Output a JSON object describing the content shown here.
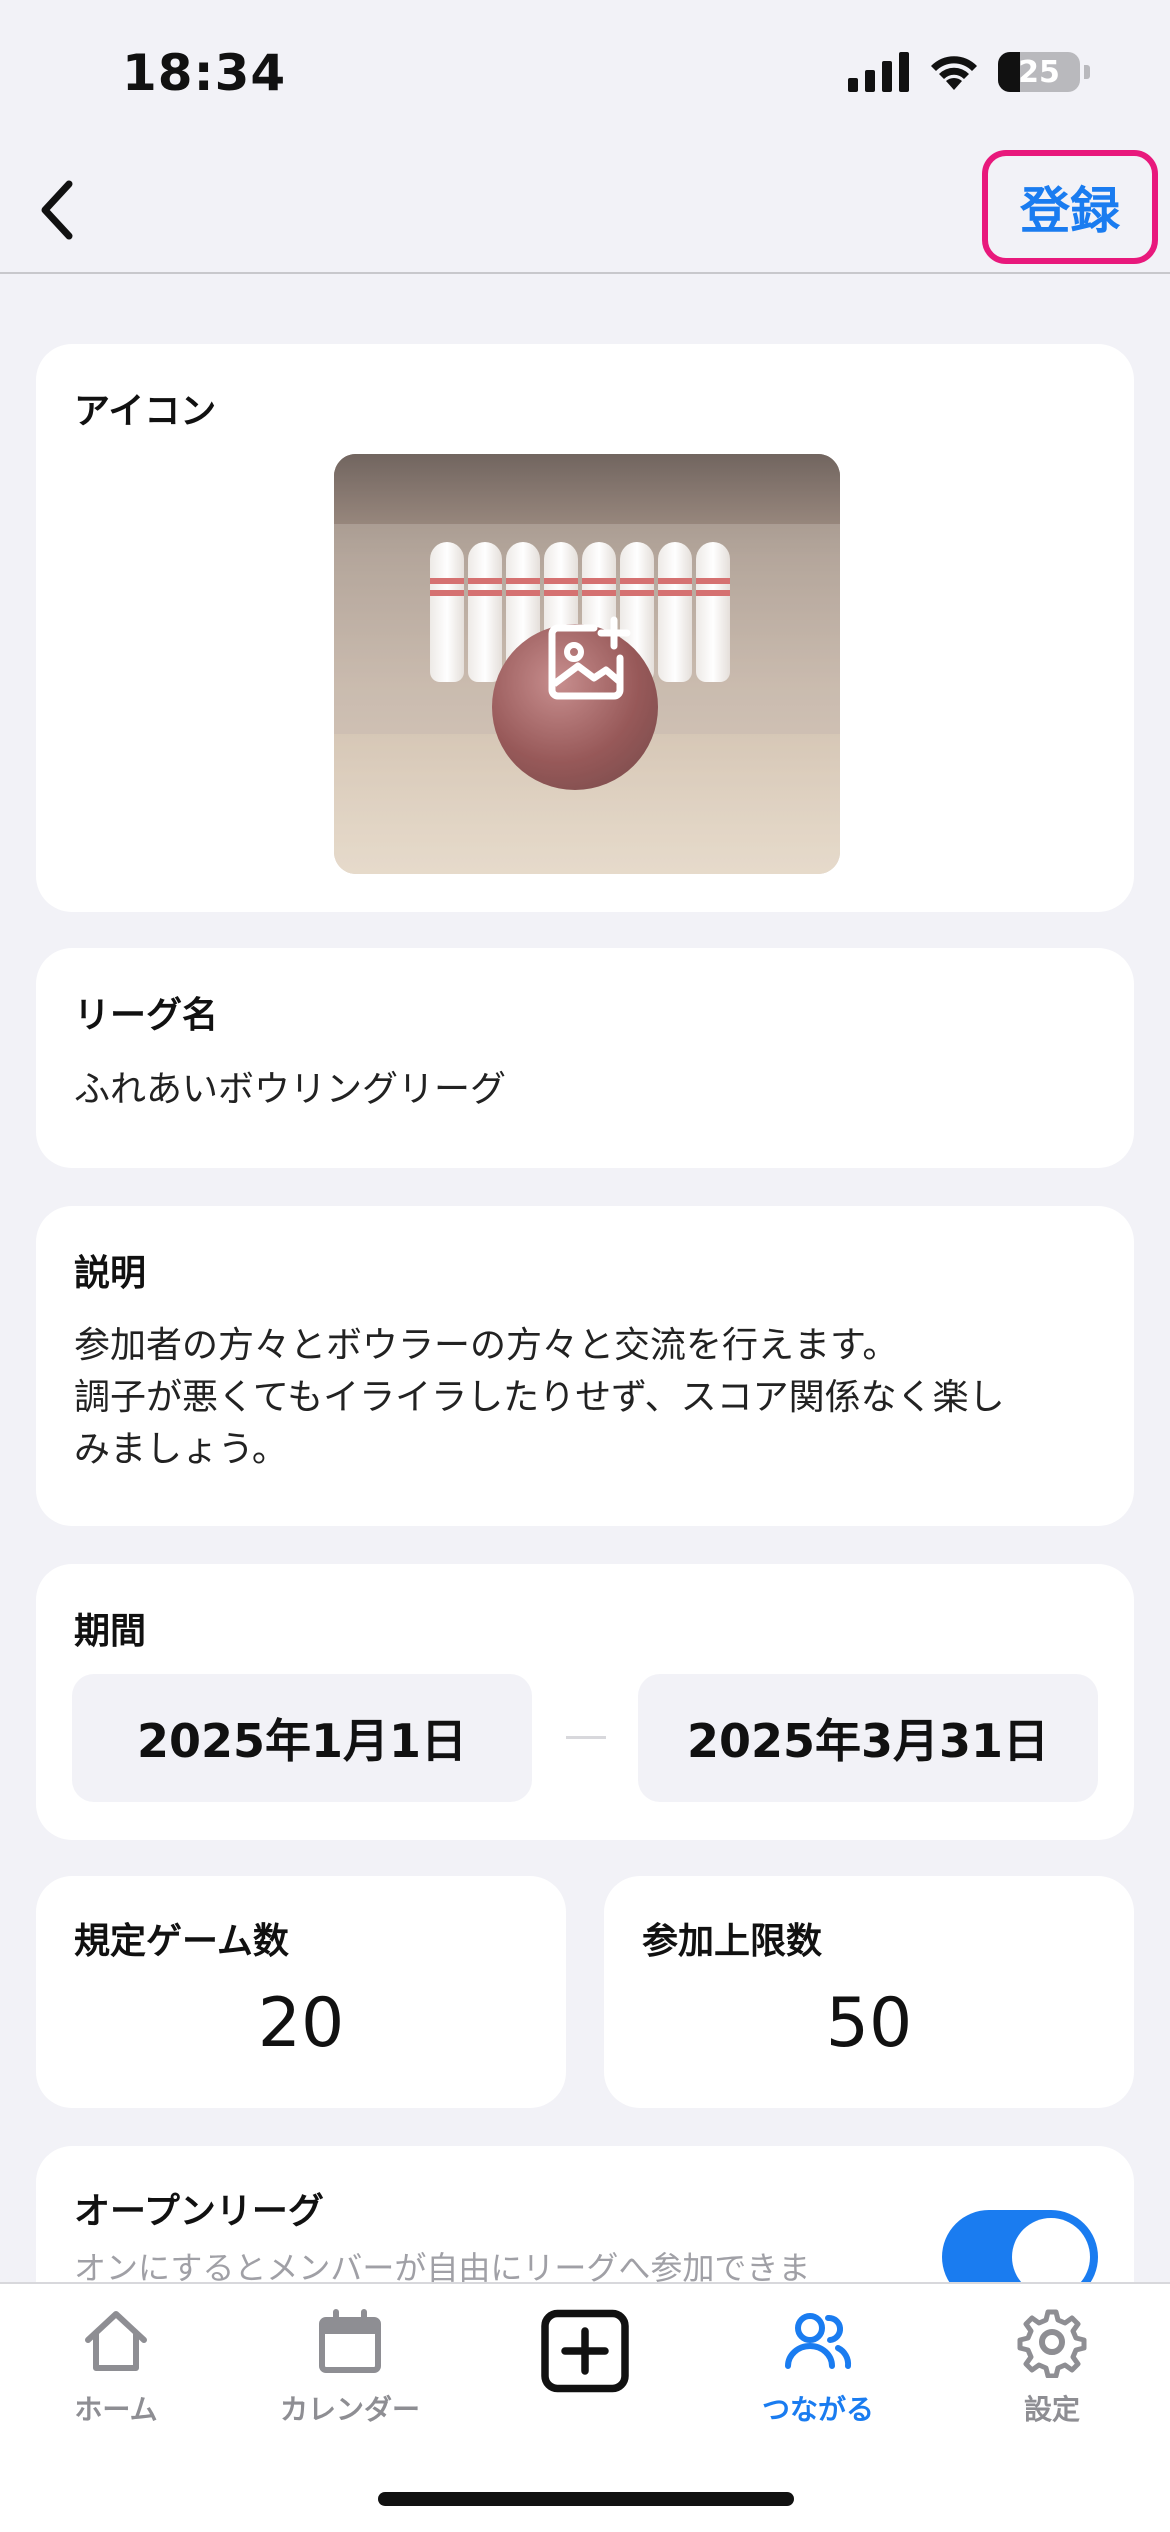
{
  "status_bar": {
    "time": "18:34",
    "battery": "25"
  },
  "nav": {
    "register_label": "登録"
  },
  "icon_section": {
    "label": "アイコン",
    "image": "bowling-ball-and-pins-photo",
    "add_icon": "add-photo-icon"
  },
  "league_name": {
    "label": "リーグ名",
    "value": "ふれあいボウリングリーグ"
  },
  "description": {
    "label": "説明",
    "line1": "参加者の方々とボウラーの方々と交流を行えます。",
    "line2": "調子が悪くてもイライラしたりせず、スコア関係なく楽し",
    "line3": "みましょう。"
  },
  "period": {
    "label": "期間",
    "start": "2025年1月1日",
    "end": "2025年3月31日"
  },
  "game_count": {
    "label": "規定ゲーム数",
    "value": "20"
  },
  "participant_limit": {
    "label": "参加上限数",
    "value": "50"
  },
  "open_league": {
    "label": "オープンリーグ",
    "description": "オンにするとメンバーが自由にリーグへ参加できま",
    "enabled": true
  },
  "tabs": [
    {
      "label": "ホーム",
      "icon": "house-icon"
    },
    {
      "label": "カレンダー",
      "icon": "calendar-icon"
    },
    {
      "label": "",
      "icon": "plus-square-icon"
    },
    {
      "label": "つながる",
      "icon": "people-icon",
      "active": true
    },
    {
      "label": "設定",
      "icon": "gear-icon"
    }
  ],
  "colors": {
    "accent": "#1a7cf0",
    "highlight": "#e8197c",
    "background": "#f2f2f7"
  }
}
